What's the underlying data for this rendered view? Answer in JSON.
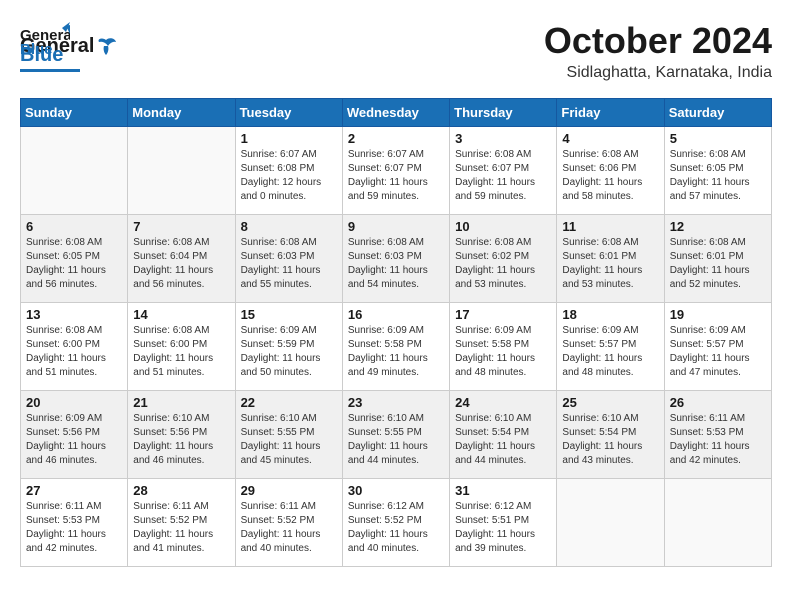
{
  "header": {
    "logo_general": "General",
    "logo_blue": "Blue",
    "month": "October 2024",
    "location": "Sidlaghatta, Karnataka, India"
  },
  "weekdays": [
    "Sunday",
    "Monday",
    "Tuesday",
    "Wednesday",
    "Thursday",
    "Friday",
    "Saturday"
  ],
  "weeks": [
    [
      {
        "day": "",
        "empty": true
      },
      {
        "day": "",
        "empty": true
      },
      {
        "day": "1",
        "sunrise": "Sunrise: 6:07 AM",
        "sunset": "Sunset: 6:08 PM",
        "daylight": "Daylight: 12 hours and 0 minutes."
      },
      {
        "day": "2",
        "sunrise": "Sunrise: 6:07 AM",
        "sunset": "Sunset: 6:07 PM",
        "daylight": "Daylight: 11 hours and 59 minutes."
      },
      {
        "day": "3",
        "sunrise": "Sunrise: 6:08 AM",
        "sunset": "Sunset: 6:07 PM",
        "daylight": "Daylight: 11 hours and 59 minutes."
      },
      {
        "day": "4",
        "sunrise": "Sunrise: 6:08 AM",
        "sunset": "Sunset: 6:06 PM",
        "daylight": "Daylight: 11 hours and 58 minutes."
      },
      {
        "day": "5",
        "sunrise": "Sunrise: 6:08 AM",
        "sunset": "Sunset: 6:05 PM",
        "daylight": "Daylight: 11 hours and 57 minutes."
      }
    ],
    [
      {
        "day": "6",
        "sunrise": "Sunrise: 6:08 AM",
        "sunset": "Sunset: 6:05 PM",
        "daylight": "Daylight: 11 hours and 56 minutes."
      },
      {
        "day": "7",
        "sunrise": "Sunrise: 6:08 AM",
        "sunset": "Sunset: 6:04 PM",
        "daylight": "Daylight: 11 hours and 56 minutes."
      },
      {
        "day": "8",
        "sunrise": "Sunrise: 6:08 AM",
        "sunset": "Sunset: 6:03 PM",
        "daylight": "Daylight: 11 hours and 55 minutes."
      },
      {
        "day": "9",
        "sunrise": "Sunrise: 6:08 AM",
        "sunset": "Sunset: 6:03 PM",
        "daylight": "Daylight: 11 hours and 54 minutes."
      },
      {
        "day": "10",
        "sunrise": "Sunrise: 6:08 AM",
        "sunset": "Sunset: 6:02 PM",
        "daylight": "Daylight: 11 hours and 53 minutes."
      },
      {
        "day": "11",
        "sunrise": "Sunrise: 6:08 AM",
        "sunset": "Sunset: 6:01 PM",
        "daylight": "Daylight: 11 hours and 53 minutes."
      },
      {
        "day": "12",
        "sunrise": "Sunrise: 6:08 AM",
        "sunset": "Sunset: 6:01 PM",
        "daylight": "Daylight: 11 hours and 52 minutes."
      }
    ],
    [
      {
        "day": "13",
        "sunrise": "Sunrise: 6:08 AM",
        "sunset": "Sunset: 6:00 PM",
        "daylight": "Daylight: 11 hours and 51 minutes."
      },
      {
        "day": "14",
        "sunrise": "Sunrise: 6:08 AM",
        "sunset": "Sunset: 6:00 PM",
        "daylight": "Daylight: 11 hours and 51 minutes."
      },
      {
        "day": "15",
        "sunrise": "Sunrise: 6:09 AM",
        "sunset": "Sunset: 5:59 PM",
        "daylight": "Daylight: 11 hours and 50 minutes."
      },
      {
        "day": "16",
        "sunrise": "Sunrise: 6:09 AM",
        "sunset": "Sunset: 5:58 PM",
        "daylight": "Daylight: 11 hours and 49 minutes."
      },
      {
        "day": "17",
        "sunrise": "Sunrise: 6:09 AM",
        "sunset": "Sunset: 5:58 PM",
        "daylight": "Daylight: 11 hours and 48 minutes."
      },
      {
        "day": "18",
        "sunrise": "Sunrise: 6:09 AM",
        "sunset": "Sunset: 5:57 PM",
        "daylight": "Daylight: 11 hours and 48 minutes."
      },
      {
        "day": "19",
        "sunrise": "Sunrise: 6:09 AM",
        "sunset": "Sunset: 5:57 PM",
        "daylight": "Daylight: 11 hours and 47 minutes."
      }
    ],
    [
      {
        "day": "20",
        "sunrise": "Sunrise: 6:09 AM",
        "sunset": "Sunset: 5:56 PM",
        "daylight": "Daylight: 11 hours and 46 minutes."
      },
      {
        "day": "21",
        "sunrise": "Sunrise: 6:10 AM",
        "sunset": "Sunset: 5:56 PM",
        "daylight": "Daylight: 11 hours and 46 minutes."
      },
      {
        "day": "22",
        "sunrise": "Sunrise: 6:10 AM",
        "sunset": "Sunset: 5:55 PM",
        "daylight": "Daylight: 11 hours and 45 minutes."
      },
      {
        "day": "23",
        "sunrise": "Sunrise: 6:10 AM",
        "sunset": "Sunset: 5:55 PM",
        "daylight": "Daylight: 11 hours and 44 minutes."
      },
      {
        "day": "24",
        "sunrise": "Sunrise: 6:10 AM",
        "sunset": "Sunset: 5:54 PM",
        "daylight": "Daylight: 11 hours and 44 minutes."
      },
      {
        "day": "25",
        "sunrise": "Sunrise: 6:10 AM",
        "sunset": "Sunset: 5:54 PM",
        "daylight": "Daylight: 11 hours and 43 minutes."
      },
      {
        "day": "26",
        "sunrise": "Sunrise: 6:11 AM",
        "sunset": "Sunset: 5:53 PM",
        "daylight": "Daylight: 11 hours and 42 minutes."
      }
    ],
    [
      {
        "day": "27",
        "sunrise": "Sunrise: 6:11 AM",
        "sunset": "Sunset: 5:53 PM",
        "daylight": "Daylight: 11 hours and 42 minutes."
      },
      {
        "day": "28",
        "sunrise": "Sunrise: 6:11 AM",
        "sunset": "Sunset: 5:52 PM",
        "daylight": "Daylight: 11 hours and 41 minutes."
      },
      {
        "day": "29",
        "sunrise": "Sunrise: 6:11 AM",
        "sunset": "Sunset: 5:52 PM",
        "daylight": "Daylight: 11 hours and 40 minutes."
      },
      {
        "day": "30",
        "sunrise": "Sunrise: 6:12 AM",
        "sunset": "Sunset: 5:52 PM",
        "daylight": "Daylight: 11 hours and 40 minutes."
      },
      {
        "day": "31",
        "sunrise": "Sunrise: 6:12 AM",
        "sunset": "Sunset: 5:51 PM",
        "daylight": "Daylight: 11 hours and 39 minutes."
      },
      {
        "day": "",
        "empty": true
      },
      {
        "day": "",
        "empty": true
      }
    ]
  ]
}
